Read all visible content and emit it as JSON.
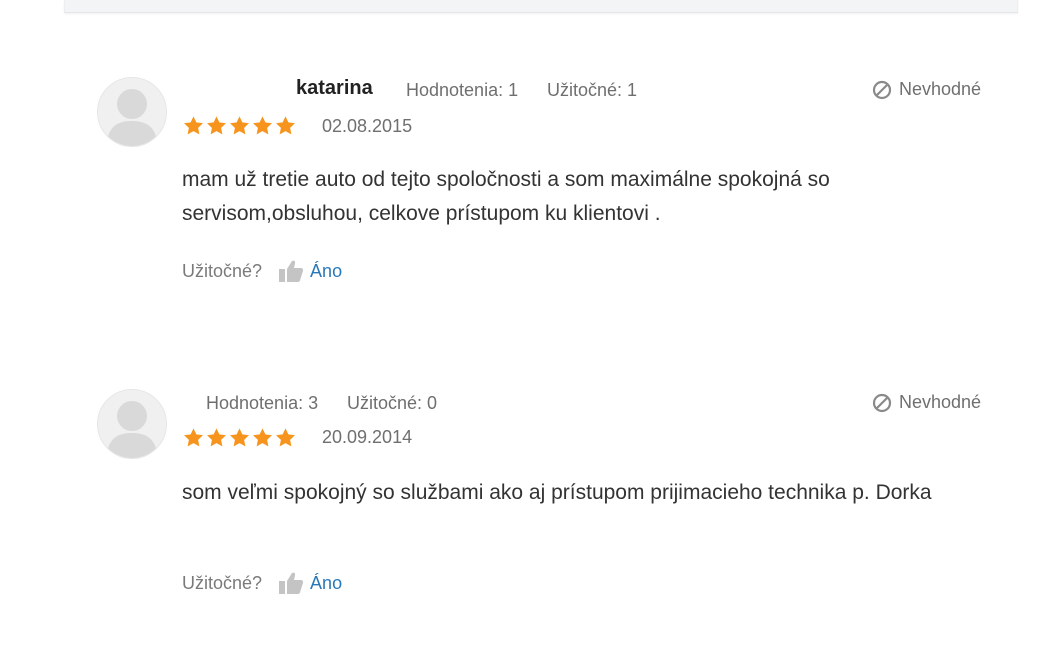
{
  "reviews": [
    {
      "author": "katarina",
      "ratings_label": "Hodnotenia: 1",
      "useful_count_label": "Užitočné: 1",
      "flag_label": "Nevhodné",
      "stars": 5,
      "date": "02.08.2015",
      "text": "mam už tretie auto od tejto spoločnosti a som maximálne spokojná so servisom,obsluhou, celkove prístupom ku klientovi .",
      "useful_question": "Užitočné?",
      "yes_label": "Áno"
    },
    {
      "author": "",
      "ratings_label": "Hodnotenia: 3",
      "useful_count_label": "Užitočné: 0",
      "flag_label": "Nevhodné",
      "stars": 5,
      "date": "20.09.2014",
      "text": "som veľmi spokojný so službami ako aj prístupom prijimacieho technika p. Dorka",
      "useful_question": "Užitočné?",
      "yes_label": "Áno"
    }
  ],
  "icons": {
    "avatar": "user-avatar-icon",
    "flag": "prohibited-icon",
    "star": "star-icon",
    "thumb": "thumbs-up-icon"
  },
  "colors": {
    "star": "#f7941d",
    "link": "#2a78b8",
    "muted_text": "#6f6f6f",
    "body_text": "#333333",
    "icon_gray": "#c4c4c4"
  }
}
